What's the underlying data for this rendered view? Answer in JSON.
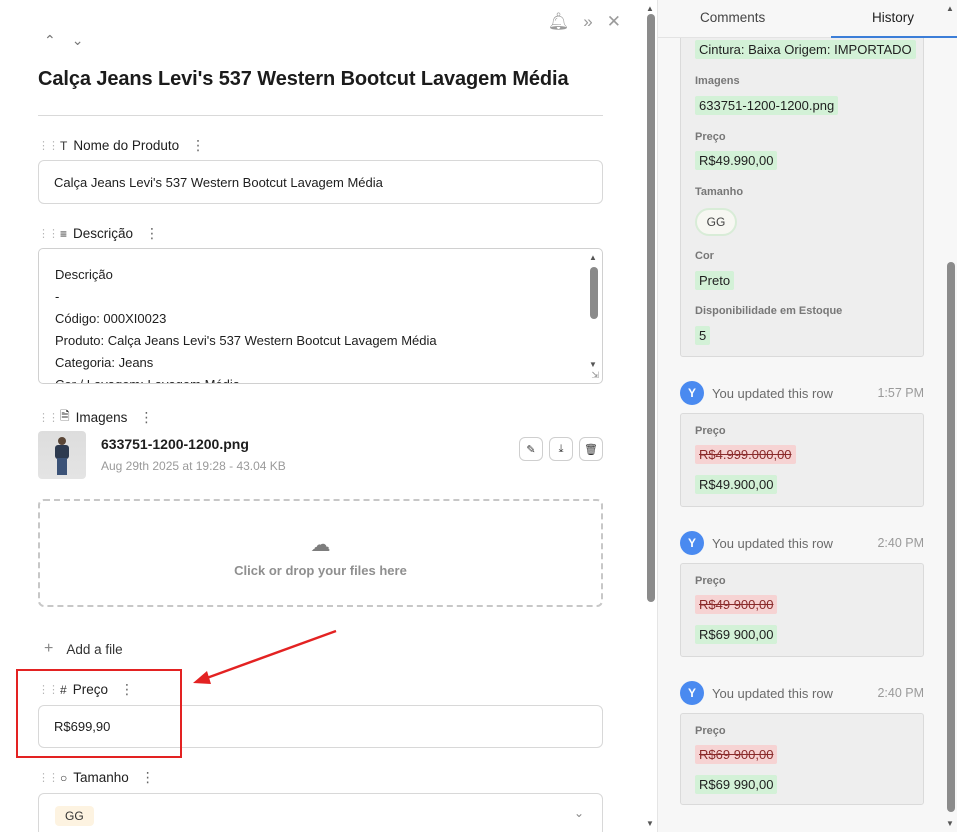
{
  "header": {
    "bell_icon": "bell-icon",
    "expand_icon": "double-chevron-right-icon",
    "close_icon": "close-icon",
    "nav_up": "⌃",
    "nav_down": "⌄",
    "title": "Calça Jeans Levi's 537 Western Bootcut Lavagem Média"
  },
  "fields": {
    "nome": {
      "label": "Nome do Produto",
      "value": "Calça Jeans Levi's 537 Western Bootcut Lavagem Média"
    },
    "descricao": {
      "label": "Descrição",
      "lines": [
        "Descrição",
        "-",
        "Código: 000XI0023",
        "Produto: Calça Jeans Levi's 537 Western Bootcut Lavagem Média",
        "Categoria: Jeans",
        "Cor / Lavagem: Lavagem Média"
      ]
    },
    "imagens": {
      "label": "Imagens",
      "file_name": "633751-1200-1200.png",
      "file_meta": "Aug 29th 2025 at 19:28 - 43.04 KB",
      "dropzone_text": "Click or drop your files here",
      "add_file": "Add a file"
    },
    "preco": {
      "label": "Preço",
      "value": "R$699,90"
    },
    "tamanho": {
      "label": "Tamanho",
      "value": "GG"
    }
  },
  "history_panel": {
    "tabs": [
      "Comments",
      "History"
    ],
    "active_tab": "History",
    "first_card": {
      "cut_line": "Cintura: Baixa Origem: IMPORTADO",
      "imagens_label": "Imagens",
      "imagens_value": "633751-1200-1200.png",
      "preco_label": "Preço",
      "preco_value": "R$49.990,00",
      "tamanho_label": "Tamanho",
      "tamanho_value": "GG",
      "cor_label": "Cor",
      "cor_value": "Preto",
      "estoque_label": "Disponibilidade em Estoque",
      "estoque_value": "5"
    },
    "events": [
      {
        "avatar": "Y",
        "text": "You updated this row",
        "time": "1:57 PM",
        "field": "Preço",
        "old": "R$4.999.000,00",
        "new": "R$49.900,00"
      },
      {
        "avatar": "Y",
        "text": "You updated this row",
        "time": "2:40 PM",
        "field": "Preço",
        "old": "R$49 900,00",
        "new": "R$69 900,00"
      },
      {
        "avatar": "Y",
        "text": "You updated this row",
        "time": "2:40 PM",
        "field": "Preço",
        "old": "R$69 900,00",
        "new": "R$69 990,00"
      }
    ]
  },
  "colors": {
    "accent": "#3c7ed8",
    "highlight_box": "#e32222",
    "added": "#d3f1d7",
    "removed": "#f6d3d3",
    "avatar": "#4a8af0"
  }
}
